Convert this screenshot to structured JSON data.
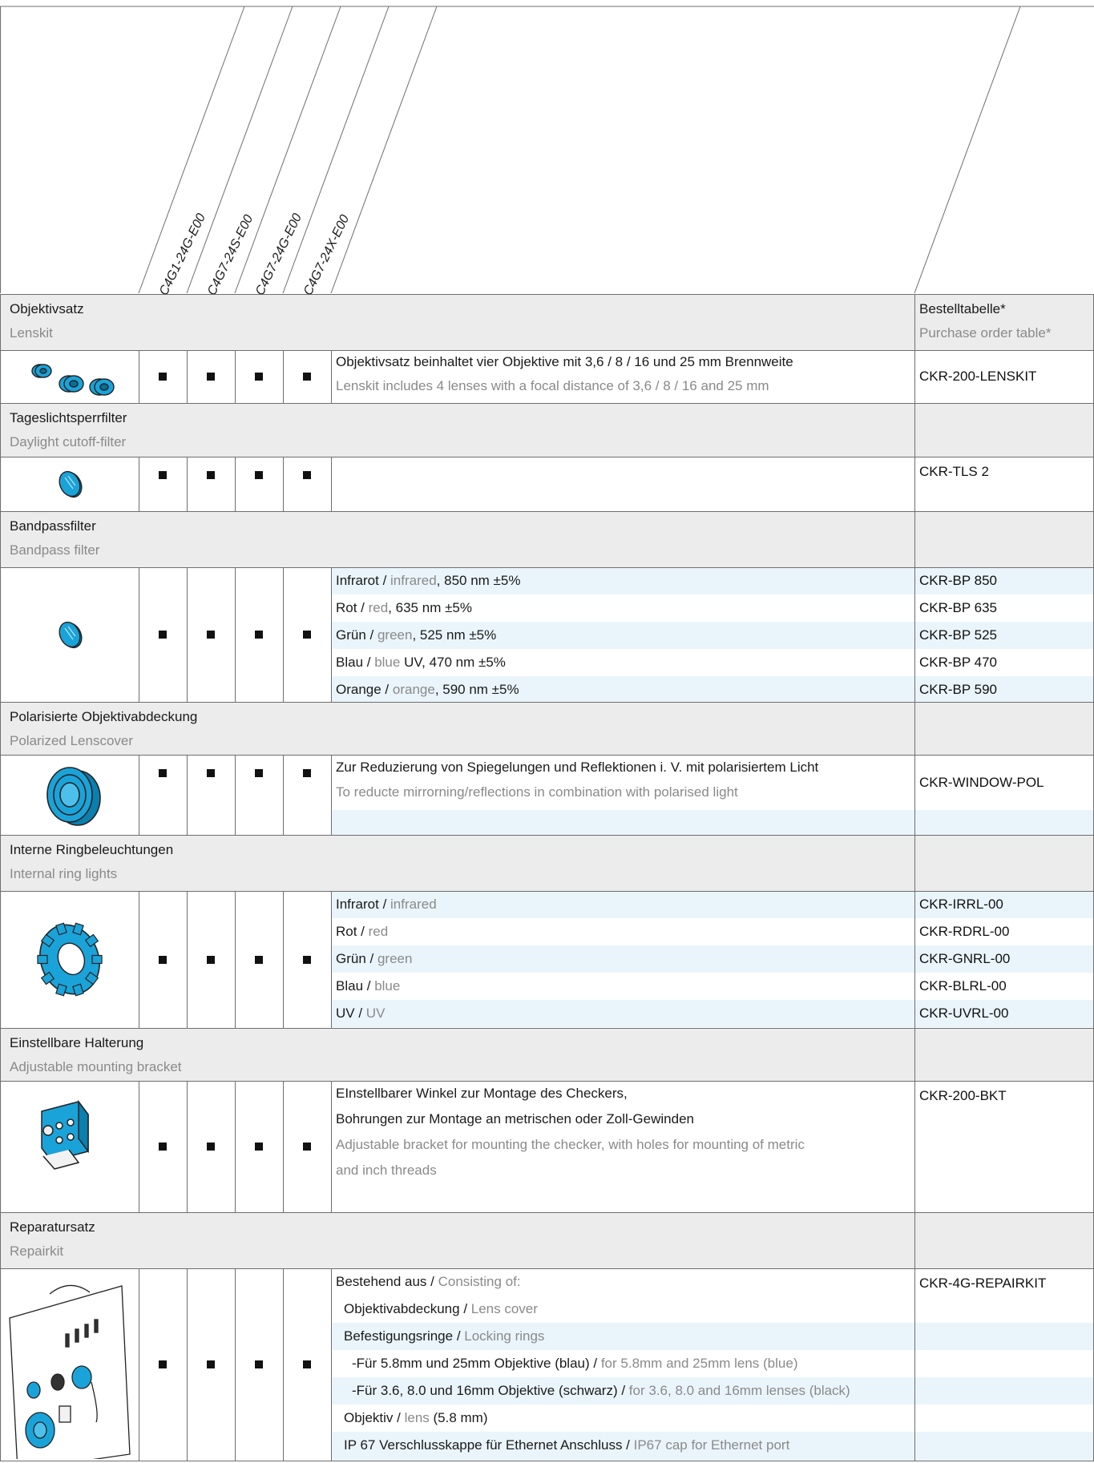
{
  "models": [
    "C4G1-24G-E00",
    "C4G7-24S-E00",
    "C4G7-24G-E00",
    "C4G7-24X-E00"
  ],
  "header": {
    "order_de": "Bestelltabelle*",
    "order_en": "Purchase order table*"
  },
  "mark_symbol": "■",
  "sections": [
    {
      "title_de": "Objektivsatz",
      "title_en": "Lenskit",
      "icon": "lens-kit-icon",
      "lines": [
        {
          "de": "Objektivsatz beinhaltet vier Objektive mit 3,6 / 8 / 16 und 25 mm Brennweite",
          "en": ""
        },
        {
          "de": "",
          "en": "Lenskit includes 4 lenses with a focal distance of 3,6 / 8 / 16 and 25 mm"
        }
      ],
      "order": "CKR-200-LENSKIT"
    },
    {
      "title_de": "Tageslichtsperrfilter",
      "title_en": "Daylight cutoff-filter",
      "icon": "filter-disc-icon",
      "lines": [],
      "order": "CKR-TLS 2"
    },
    {
      "title_de": "Bandpassfilter",
      "title_en": "Bandpass filter",
      "icon": "filter-disc-icon",
      "lines": [
        {
          "de": "Infrarot / ",
          "en": "infrared",
          "tail": ", 850 nm ±5%",
          "order": "CKR-BP 850"
        },
        {
          "de": "Rot / ",
          "en": "red",
          "tail": ", 635 nm ±5%",
          "order": "CKR-BP 635"
        },
        {
          "de": "Grün / ",
          "en": "green",
          "tail": ", 525 nm ±5%",
          "order": "CKR-BP 525"
        },
        {
          "de": "Blau / ",
          "en": "blue",
          "tail": " UV, 470 nm ±5%",
          "order": "CKR-BP 470"
        },
        {
          "de": "Orange / ",
          "en": "orange",
          "tail": ", 590 nm ±5%",
          "order": "CKR-BP 590"
        }
      ]
    },
    {
      "title_de": "Polarisierte Objektivabdeckung",
      "title_en": "Polarized Lenscover",
      "icon": "lens-cover-icon",
      "lines": [
        {
          "de": "Zur Reduzierung von Spiegelungen und Reflektionen i. V. mit polarisiertem Licht",
          "en": ""
        },
        {
          "de": "",
          "en": "To reducte mirrorning/reflections in combination with polarised light"
        }
      ],
      "order": "CKR-WINDOW-POL"
    },
    {
      "title_de": "Interne Ringbeleuchtungen",
      "title_en": "Internal ring lights",
      "icon": "ring-light-icon",
      "lines": [
        {
          "de": "Infrarot / ",
          "en": "infrared",
          "order": "CKR-IRRL-00"
        },
        {
          "de": "Rot / ",
          "en": "red",
          "order": "CKR-RDRL-00"
        },
        {
          "de": "Grün / ",
          "en": "green",
          "order": "CKR-GNRL-00"
        },
        {
          "de": "Blau / ",
          "en": "blue",
          "order": "CKR-BLRL-00"
        },
        {
          "de": "UV / ",
          "en": "UV",
          "order": "CKR-UVRL-00"
        }
      ]
    },
    {
      "title_de": "Einstellbare Halterung",
      "title_en": "Adjustable mounting bracket",
      "icon": "bracket-icon",
      "lines": [
        {
          "de": "EInstellbarer Winkel zur Montage des Checkers,",
          "en": ""
        },
        {
          "de": "Bohrungen zur Montage an metrischen oder Zoll-Gewinden",
          "en": ""
        },
        {
          "de": "",
          "en": "Adjustable bracket for mounting the checker, with holes for mounting of metric"
        },
        {
          "de": "",
          "en": "and inch threads"
        }
      ],
      "order": "CKR-200-BKT"
    },
    {
      "title_de": "Reparatursatz",
      "title_en": "Repairkit",
      "icon": "repair-kit-icon",
      "lines": [
        {
          "de": "Bestehend aus / ",
          "en": "Consisting of:"
        },
        {
          "de": "Objektivabdeckung / ",
          "en": "Lens cover"
        },
        {
          "de": "Befestigungsringe / ",
          "en": "Locking rings"
        },
        {
          "de": "-Für 5.8mm und 25mm Objektive (blau) / ",
          "en": "for 5.8mm and 25mm lens (blue)"
        },
        {
          "de": "-Für 3.6, 8.0 und 16mm Objektive (schwarz) / ",
          "en": "for 3.6, 8.0 and 16mm lenses (black)"
        },
        {
          "de": "Objektiv / ",
          "en": "lens",
          "tail": " (5.8 mm)"
        },
        {
          "de": "IP 67 Verschlusskappe für Ethernet Anschluss / ",
          "en": "IP67 cap for Ethernet port"
        }
      ],
      "order": "CKR-4G-REPAIRKIT"
    }
  ],
  "colors": {
    "accent": "#1aa3d9",
    "grey_row": "#ececec",
    "tint_row": "#eaf5fb",
    "secondary_text": "#8a8a8a"
  }
}
